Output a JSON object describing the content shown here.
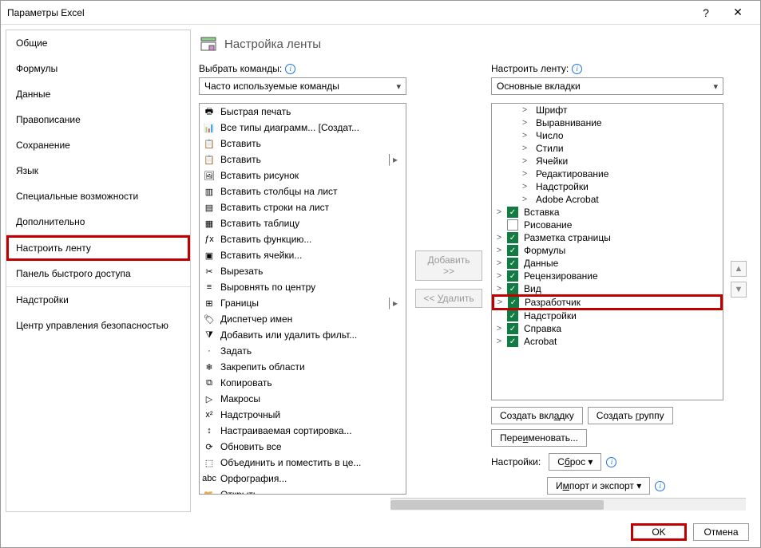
{
  "window": {
    "title": "Параметры Excel"
  },
  "sidebar": {
    "items": [
      "Общие",
      "Формулы",
      "Данные",
      "Правописание",
      "Сохранение",
      "Язык",
      "Специальные возможности",
      "Дополнительно",
      "Настроить ленту",
      "Панель быстрого доступа",
      "Надстройки",
      "Центр управления безопасностью"
    ],
    "selected_index": 8
  },
  "header": {
    "title": "Настройка ленты"
  },
  "left": {
    "label": "Выбрать команды:",
    "dropdown": "Часто используемые команды",
    "items": [
      {
        "icon": "printer-icon",
        "label": "Быстрая печать"
      },
      {
        "icon": "chart-icon",
        "label": "Все типы диаграмм... [Создат..."
      },
      {
        "icon": "paste-icon",
        "label": "Вставить"
      },
      {
        "icon": "paste-icon",
        "label": "Вставить",
        "expand": true
      },
      {
        "icon": "image-icon",
        "label": "Вставить рисунок"
      },
      {
        "icon": "columns-icon",
        "label": "Вставить столбцы на лист"
      },
      {
        "icon": "rows-icon",
        "label": "Вставить строки на лист"
      },
      {
        "icon": "table-icon",
        "label": "Вставить таблицу"
      },
      {
        "icon": "fx-icon",
        "label": "Вставить функцию..."
      },
      {
        "icon": "cells-icon",
        "label": "Вставить ячейки..."
      },
      {
        "icon": "scissors-icon",
        "label": "Вырезать"
      },
      {
        "icon": "align-center-icon",
        "label": "Выровнять по центру"
      },
      {
        "icon": "borders-icon",
        "label": "Границы",
        "expand": true
      },
      {
        "icon": "name-manager-icon",
        "label": "Диспетчер имен"
      },
      {
        "icon": "filter-icon",
        "label": "Добавить или удалить фильт..."
      },
      {
        "icon": "blank-icon",
        "label": "Задать"
      },
      {
        "icon": "freeze-icon",
        "label": "Закрепить области"
      },
      {
        "icon": "copy-icon",
        "label": "Копировать"
      },
      {
        "icon": "play-icon",
        "label": "Макросы"
      },
      {
        "icon": "superscript-icon",
        "label": "Надстрочный"
      },
      {
        "icon": "sort-icon",
        "label": "Настраиваемая сортировка..."
      },
      {
        "icon": "refresh-icon",
        "label": "Обновить все"
      },
      {
        "icon": "merge-icon",
        "label": "Объединить и поместить в це..."
      },
      {
        "icon": "spell-icon",
        "label": "Орфография..."
      },
      {
        "icon": "open-icon",
        "label": "Открыть"
      }
    ]
  },
  "mid": {
    "add": "Добавить >>",
    "remove": "<< Удалить"
  },
  "right": {
    "label": "Настроить ленту:",
    "dropdown": "Основные вкладки",
    "tree": [
      {
        "indent": 2,
        "chev": ">",
        "chk": null,
        "label": "Шрифт"
      },
      {
        "indent": 2,
        "chev": ">",
        "chk": null,
        "label": "Выравнивание"
      },
      {
        "indent": 2,
        "chev": ">",
        "chk": null,
        "label": "Число"
      },
      {
        "indent": 2,
        "chev": ">",
        "chk": null,
        "label": "Стили"
      },
      {
        "indent": 2,
        "chev": ">",
        "chk": null,
        "label": "Ячейки"
      },
      {
        "indent": 2,
        "chev": ">",
        "chk": null,
        "label": "Редактирование"
      },
      {
        "indent": 2,
        "chev": ">",
        "chk": null,
        "label": "Надстройки"
      },
      {
        "indent": 2,
        "chev": ">",
        "chk": null,
        "label": "Adobe Acrobat"
      },
      {
        "indent": 0,
        "chev": ">",
        "chk": true,
        "label": "Вставка"
      },
      {
        "indent": 0,
        "chev": "",
        "chk": false,
        "label": "Рисование"
      },
      {
        "indent": 0,
        "chev": ">",
        "chk": true,
        "label": "Разметка страницы"
      },
      {
        "indent": 0,
        "chev": ">",
        "chk": true,
        "label": "Формулы"
      },
      {
        "indent": 0,
        "chev": ">",
        "chk": true,
        "label": "Данные"
      },
      {
        "indent": 0,
        "chev": ">",
        "chk": true,
        "label": "Рецензирование"
      },
      {
        "indent": 0,
        "chev": ">",
        "chk": true,
        "label": "Вид"
      },
      {
        "indent": 0,
        "chev": ">",
        "chk": true,
        "label": "Разработчик",
        "highlight": true
      },
      {
        "indent": 0,
        "chev": "",
        "chk": true,
        "label": "Надстройки"
      },
      {
        "indent": 0,
        "chev": ">",
        "chk": true,
        "label": "Справка"
      },
      {
        "indent": 0,
        "chev": ">",
        "chk": true,
        "label": "Acrobat"
      }
    ],
    "buttons": {
      "new_tab": "Создать вкладку",
      "new_group": "Создать группу",
      "rename": "Переименовать...",
      "settings_label": "Настройки:",
      "reset": "Сброс",
      "import_export": "Импорт и экспорт"
    }
  },
  "footer": {
    "ok": "OK",
    "cancel": "Отмена"
  }
}
